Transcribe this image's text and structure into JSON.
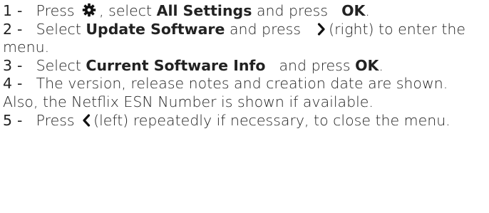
{
  "steps": [
    {
      "number": "1 -",
      "parts": {
        "t1": "Press",
        "icon": "gear-icon",
        "t2": ", select",
        "bold1": "All Settings",
        "t3": "and press",
        "bold2": "OK",
        "t4": "."
      }
    },
    {
      "number": "2 -",
      "parts": {
        "t1": "Select",
        "bold1": "Update Software",
        "t2": "and press",
        "icon": "chevron-right-icon",
        "t3": "(right) to enter the menu."
      }
    },
    {
      "number": "3 -",
      "parts": {
        "t1": "Select",
        "bold1": "Current Software Info",
        "t2": "and press",
        "bold2": "OK",
        "t3": "."
      }
    },
    {
      "number": "4 -",
      "parts": {
        "t1": "The version, release notes and creation date are shown. Also, the Netflix ESN Number is shown if available."
      }
    },
    {
      "number": "5 -",
      "parts": {
        "t1": "Press",
        "icon": "chevron-left-icon",
        "t2": "(left) repeatedly if necessary, to close the menu."
      }
    }
  ],
  "colors": {
    "text": "#222222",
    "icon": "#111111"
  }
}
